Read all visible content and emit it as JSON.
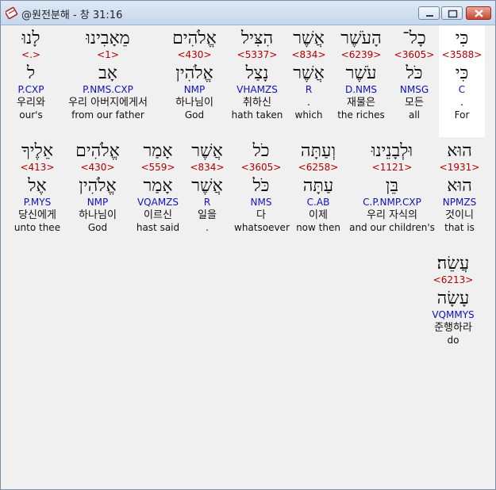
{
  "window": {
    "title": "@원전분해 - 창 31:16"
  },
  "rows": [
    {
      "words": [
        {
          "hebrew": "כִּי",
          "strong": "<3588>",
          "lexeme": "כִּי",
          "morph": "C",
          "korean": ".",
          "english": "For",
          "highlight": true
        },
        {
          "hebrew": "כָל־",
          "strong": "<3605>",
          "lexeme": "כֹּל",
          "morph": "NMSG",
          "korean": "모든",
          "english": "all"
        },
        {
          "hebrew": "הָעֹשֶׁר",
          "strong": "<6239>",
          "lexeme": "עֹשֶׁר",
          "morph": "D.NMS",
          "korean": "재물은",
          "english": "the riches"
        },
        {
          "hebrew": "אֲשֶׁר",
          "strong": "<834>",
          "lexeme": "אֲשֶׁר",
          "morph": "R",
          "korean": ".",
          "english": "which"
        },
        {
          "hebrew": "הִצִּיל",
          "strong": "<5337>",
          "lexeme": "נָצַל",
          "morph": "VHAMZS",
          "korean": "취하신",
          "english": "hath taken"
        },
        {
          "hebrew": "אֱלֹהִים",
          "strong": "<430>",
          "lexeme": "אֱלֹהִין",
          "morph": "NMP",
          "korean": "하나님이",
          "english": "God"
        },
        {
          "hebrew": "מֵאָבִינוּ",
          "strong": "<1>",
          "lexeme": "אָב",
          "morph": "P.NMS.CXP",
          "korean": "우리 아버지에게서",
          "english": "from our father"
        },
        {
          "hebrew": "לָנוּ",
          "strong": "<.>",
          "lexeme": "ל",
          "morph": "P.CXP",
          "korean": "우리와",
          "english": "our's"
        }
      ]
    },
    {
      "words": [
        {
          "hebrew": "הוּא",
          "strong": "<1931>",
          "lexeme": "הוּא",
          "morph": "NPMZS",
          "korean": "것이니",
          "english": "that is"
        },
        {
          "hebrew": "וּלְבָנֵינוּ",
          "strong": "<1121>",
          "lexeme": "בֵּן",
          "morph": "C.P.NMP.CXP",
          "korean": "우리 자식의",
          "english": "and our children's"
        },
        {
          "hebrew": "וְעַתָּה",
          "strong": "<6258>",
          "lexeme": "עַתָּה",
          "morph": "C.AB",
          "korean": "이제",
          "english": "now then"
        },
        {
          "hebrew": "כֹל",
          "strong": "<3605>",
          "lexeme": "כֹּל",
          "morph": "NMS",
          "korean": "다",
          "english": "whatsoever"
        },
        {
          "hebrew": "אֲשֶׁר",
          "strong": "<834>",
          "lexeme": "אֲשֶׁר",
          "morph": "R",
          "korean": "일을",
          "english": "."
        },
        {
          "hebrew": "אָמַר",
          "strong": "<559>",
          "lexeme": "אָמַר",
          "morph": "VQAMZS",
          "korean": "이르신",
          "english": "hast said"
        },
        {
          "hebrew": "אֱלֹהִים",
          "strong": "<430>",
          "lexeme": "אֱלֹהִין",
          "morph": "NMP",
          "korean": "하나님이",
          "english": "God"
        },
        {
          "hebrew": "אֵלֶיךָ",
          "strong": "<413>",
          "lexeme": "אֶל",
          "morph": "P.MYS",
          "korean": "당신에게",
          "english": "unto thee"
        }
      ]
    },
    {
      "words": [
        {
          "hebrew": "עֲשֵׂה׃",
          "strong": "<6213>",
          "lexeme": "עָשָׂה",
          "morph": "VQMMYS",
          "korean": "준행하라",
          "english": "do"
        }
      ]
    }
  ]
}
